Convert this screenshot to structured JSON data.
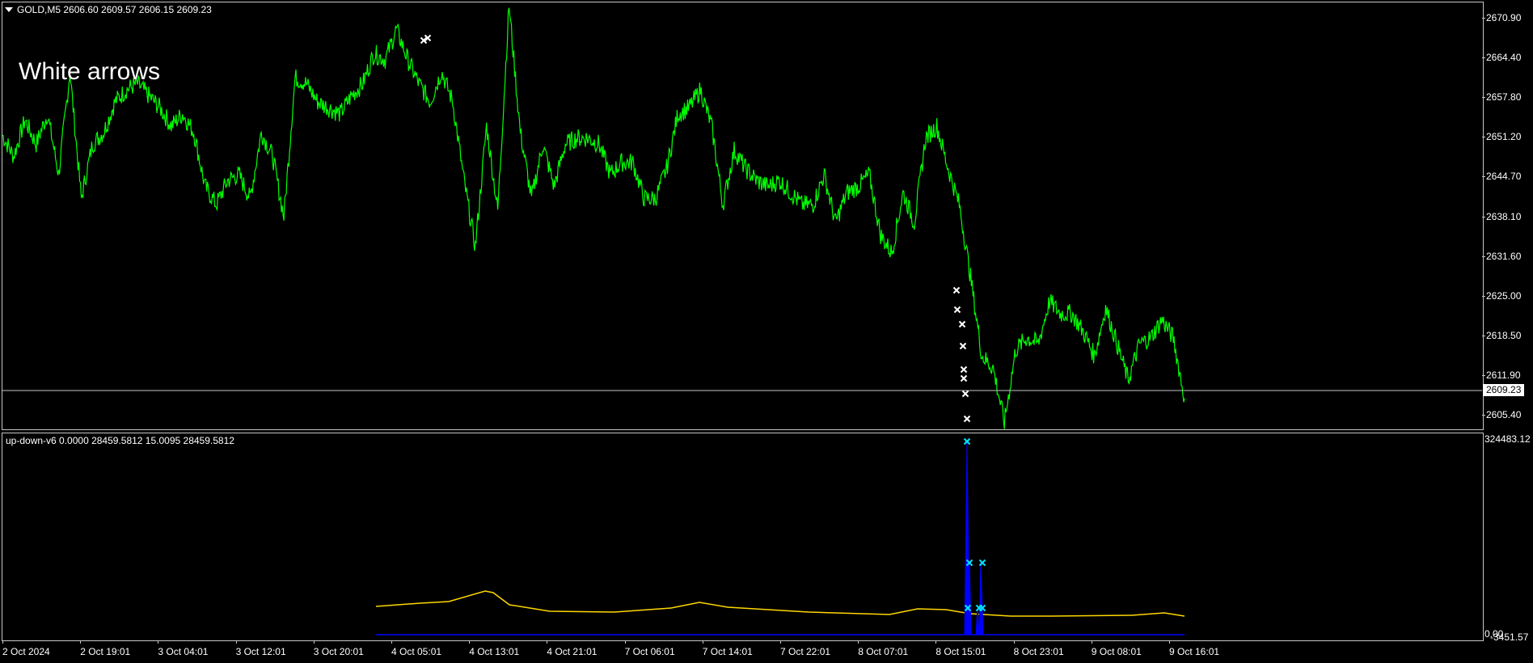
{
  "header": {
    "symbol_info": "GOLD,M5  2606.60 2609.57 2606.15 2609.23",
    "dropdown_icon": "triangle-down-icon"
  },
  "annotation": "White arrows",
  "price_axis": {
    "ticks": [
      "2670.90",
      "2664.40",
      "2657.80",
      "2651.20",
      "2644.70",
      "2638.10",
      "2631.60",
      "2625.00",
      "2618.50",
      "2611.90",
      "2605.40"
    ],
    "current_price": "2609.23"
  },
  "indicator": {
    "info": "up-down-v6 0.0000 28459.5812 15.0095 28459.5812",
    "ticks": [
      "324483.12",
      "0.00",
      "-3451.57"
    ]
  },
  "time_axis": {
    "ticks": [
      "2 Oct 2024",
      "2 Oct 19:01",
      "3 Oct 04:01",
      "3 Oct 12:01",
      "3 Oct 20:01",
      "4 Oct 05:01",
      "4 Oct 13:01",
      "4 Oct 21:01",
      "7 Oct 06:01",
      "7 Oct 14:01",
      "7 Oct 22:01",
      "8 Oct 07:01",
      "8 Oct 15:01",
      "8 Oct 23:01",
      "9 Oct 08:01",
      "9 Oct 16:01"
    ]
  },
  "colors": {
    "background": "#000000",
    "price_line": "#00ff00",
    "indicator_smooth": "#ffd700",
    "indicator_spike": "#0000ff",
    "indicator_baseline": "#0000ff",
    "arrow_main": "#ffffff",
    "arrow_indicator": "#00e5ff",
    "frame": "#c8c8c8"
  },
  "chart_data": {
    "type": "line",
    "series": [
      {
        "values": [
          2651.5,
          2648,
          2654,
          2650,
          2655,
          2645,
          2662,
          2641,
          2650,
          2652,
          2657,
          2659,
          2660,
          2658,
          2656,
          2653,
          2655,
          2652,
          2643,
          2640,
          2644,
          2645,
          2641,
          2652,
          2648,
          2638,
          2661,
          2660,
          2657,
          2656,
          2655,
          2658,
          2660,
          2665,
          2664,
          2669,
          2664,
          2660,
          2657,
          2662,
          2657,
          2644,
          2633,
          2653,
          2639,
          2673,
          2652,
          2641,
          2650,
          2643,
          2650,
          2651,
          2651,
          2650,
          2645,
          2647,
          2647,
          2641,
          2641,
          2646,
          2655,
          2656,
          2659,
          2653,
          2640,
          2649,
          2646,
          2644,
          2643,
          2644,
          2642,
          2640,
          2640,
          2645,
          2637,
          2642,
          2643,
          2645,
          2635,
          2632,
          2642,
          2637,
          2651,
          2653,
          2646,
          2640,
          2628,
          2615,
          2613,
          2604,
          2616,
          2618,
          2617,
          2624,
          2622,
          2622,
          2619,
          2615,
          2623,
          2617,
          2611,
          2617,
          2618,
          2621,
          2618,
          2608
        ]
      }
    ]
  }
}
